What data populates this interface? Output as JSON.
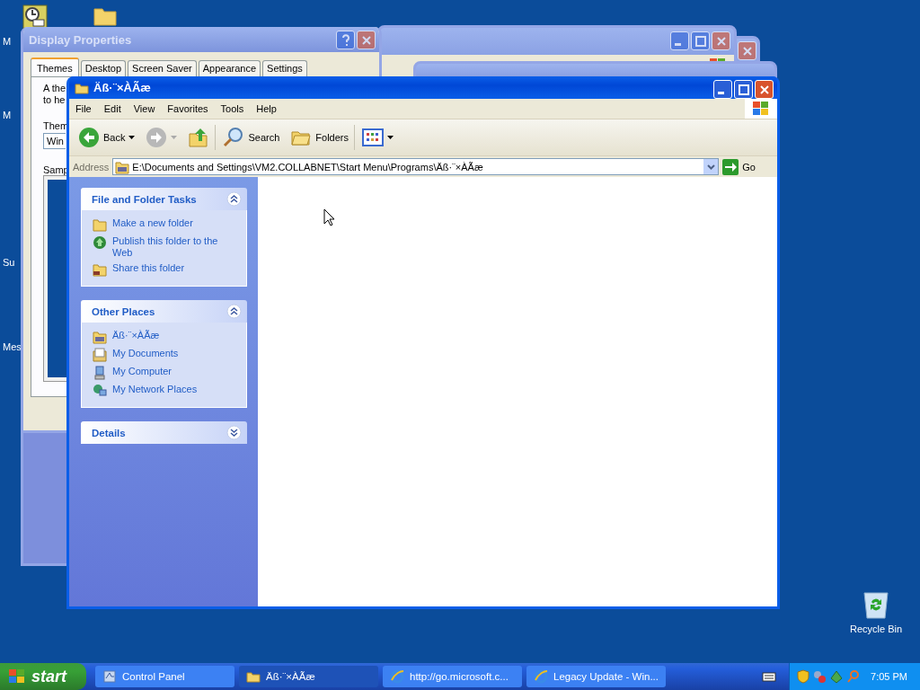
{
  "desktop": {
    "cut_labels": [
      "M",
      "M",
      "Su",
      "Mes"
    ],
    "recycle_bin": "Recycle Bin"
  },
  "display_properties": {
    "title": "Display Properties",
    "tabs": [
      {
        "label": "Themes",
        "selected": true
      },
      {
        "label": "Desktop",
        "selected": false
      },
      {
        "label": "Screen Saver",
        "selected": false
      },
      {
        "label": "Appearance",
        "selected": false
      },
      {
        "label": "Settings",
        "selected": false
      }
    ],
    "text_lines": [
      "A the",
      "to he"
    ],
    "theme_label": "Them",
    "theme_value": "Win",
    "sample_label": "Samp"
  },
  "explorer": {
    "title": "Äß·¨×ÀÃæ",
    "menu": [
      "File",
      "Edit",
      "View",
      "Favorites",
      "Tools",
      "Help"
    ],
    "toolbar": [
      {
        "kind": "back",
        "label": "Back",
        "disabled": false
      },
      {
        "kind": "forward",
        "disabled": true
      },
      {
        "kind": "up"
      },
      {
        "kind": "search",
        "label": "Search"
      },
      {
        "kind": "folders",
        "label": "Folders"
      },
      {
        "kind": "views"
      }
    ],
    "address_label": "Address",
    "address": "E:\\Documents and Settings\\VM2.COLLABNET\\Start Menu\\Programs\\Äß·¨×ÀÃæ",
    "go": "Go",
    "panes": [
      {
        "title": "File and Folder Tasks",
        "expanded": true,
        "items": [
          "Make a new folder",
          "Publish this folder to the Web",
          "Share this folder"
        ]
      },
      {
        "title": "Other Places",
        "expanded": true,
        "items": [
          "Äß·¨×ÀÃæ",
          "My Documents",
          "My Computer",
          "My Network Places"
        ]
      },
      {
        "title": "Details",
        "expanded": false
      }
    ]
  },
  "taskbar": {
    "start": "start",
    "tasks": [
      {
        "label": "Control Panel",
        "selected": false
      },
      {
        "label": "Äß·¨×ÀÃæ",
        "selected": true
      },
      {
        "label": "http://go.microsoft.c...",
        "selected": false
      },
      {
        "label": "Legacy Update - Win...",
        "selected": false
      }
    ],
    "clock": "7:05 PM"
  }
}
